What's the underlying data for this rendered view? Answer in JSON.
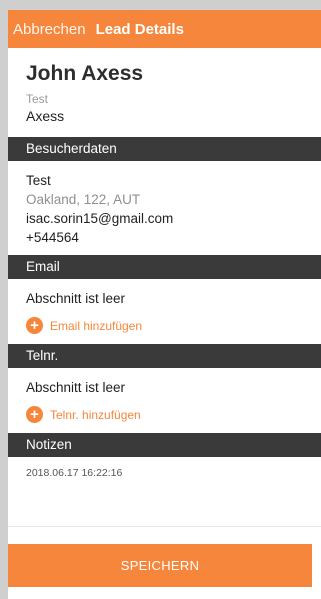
{
  "header": {
    "cancel_label": "Abbrechen",
    "title": "Lead Details"
  },
  "contact": {
    "name": "John Axess",
    "subtitle": "Test",
    "company": "Axess"
  },
  "sections": {
    "visitor": {
      "header": "Besucherdaten",
      "lines": [
        "Test",
        "Oakland, 122, AUT",
        "isac.sorin15@gmail.com",
        "+544564"
      ]
    },
    "email": {
      "header": "Email",
      "empty_text": "Abschnitt ist leer",
      "add_label": "Email hinzufügen"
    },
    "phone": {
      "header": "Telnr.",
      "empty_text": "Abschnitt ist leer",
      "add_label": "Telnr. hinzufügen"
    },
    "notes": {
      "header": "Notizen",
      "timestamp": "2018.06.17 16:22:16"
    }
  },
  "footer": {
    "save_label": "SPEICHERN"
  },
  "colors": {
    "accent": "#f5863c",
    "section_bg": "#3a3a3a"
  },
  "icons": {
    "add": "plus-circle-icon"
  }
}
